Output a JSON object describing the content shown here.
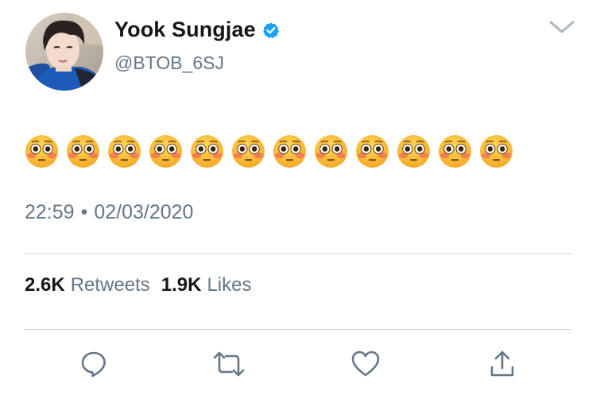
{
  "tweet": {
    "author": {
      "display_name": "Yook Sungjae",
      "handle": "@BTOB_6SJ",
      "verified": true
    },
    "text_emojis": [
      "flushed-face",
      "flushed-face",
      "flushed-face",
      "flushed-face",
      "flushed-face",
      "flushed-face",
      "flushed-face",
      "flushed-face",
      "flushed-face",
      "flushed-face",
      "flushed-face",
      "flushed-face"
    ],
    "time": "22:59",
    "separator": "•",
    "date": "02/03/2020",
    "stats": {
      "retweets_count": "2.6K",
      "retweets_label": "Retweets",
      "likes_count": "1.9K",
      "likes_label": "Likes"
    },
    "actions": [
      "reply-icon",
      "retweet-icon",
      "like-icon",
      "share-icon"
    ]
  },
  "colors": {
    "primary_text": "#14171a",
    "secondary_text": "#657786",
    "verified_blue": "#1da1f2",
    "divider": "#cfd6dc",
    "emoji_face": "#fbb63a"
  }
}
